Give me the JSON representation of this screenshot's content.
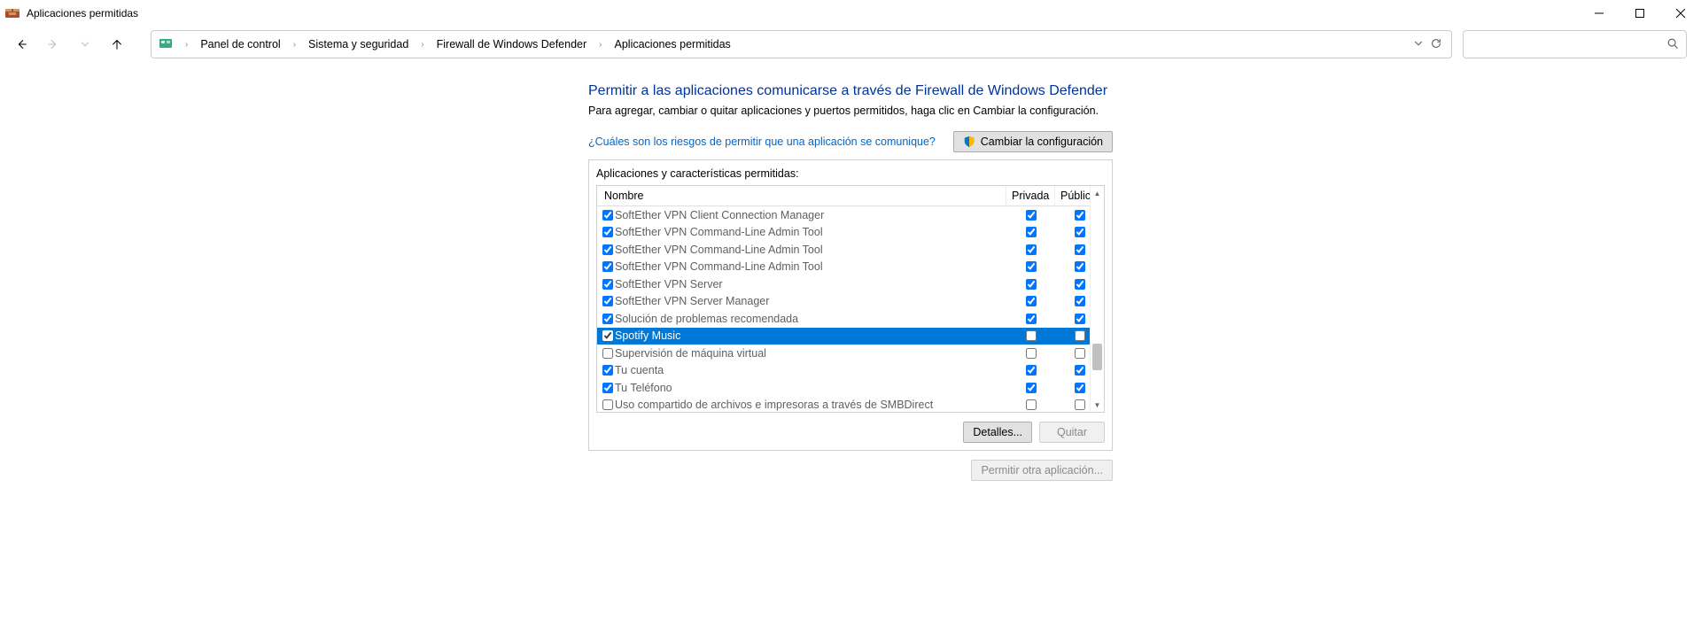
{
  "window": {
    "title": "Aplicaciones permitidas"
  },
  "breadcrumb": {
    "items": [
      "Panel de control",
      "Sistema y seguridad",
      "Firewall de Windows Defender",
      "Aplicaciones permitidas"
    ]
  },
  "page": {
    "heading": "Permitir a las aplicaciones comunicarse a través de Firewall de Windows Defender",
    "subtext": "Para agregar, cambiar o quitar aplicaciones y puertos permitidos, haga clic en Cambiar la configuración.",
    "risks_link": "¿Cuáles son los riesgos de permitir que una aplicación se comunique?",
    "change_button": "Cambiar la configuración",
    "groupbox_label": "Aplicaciones y características permitidas:",
    "columns": {
      "name": "Nombre",
      "private": "Privada",
      "public": "Pública"
    },
    "details_button": "Detalles...",
    "remove_button": "Quitar",
    "allow_other_button": "Permitir otra aplicación..."
  },
  "apps": [
    {
      "enabled": true,
      "name": "SoftEther VPN Client Connection Manager",
      "private": true,
      "public": true,
      "selected": false
    },
    {
      "enabled": true,
      "name": "SoftEther VPN Command-Line Admin Tool",
      "private": true,
      "public": true,
      "selected": false
    },
    {
      "enabled": true,
      "name": "SoftEther VPN Command-Line Admin Tool",
      "private": true,
      "public": true,
      "selected": false
    },
    {
      "enabled": true,
      "name": "SoftEther VPN Command-Line Admin Tool",
      "private": true,
      "public": true,
      "selected": false
    },
    {
      "enabled": true,
      "name": "SoftEther VPN Server",
      "private": true,
      "public": true,
      "selected": false
    },
    {
      "enabled": true,
      "name": "SoftEther VPN Server Manager",
      "private": true,
      "public": true,
      "selected": false
    },
    {
      "enabled": true,
      "name": "Solución de problemas recomendada",
      "private": true,
      "public": true,
      "selected": false
    },
    {
      "enabled": true,
      "name": "Spotify Music",
      "private": false,
      "public": false,
      "selected": true
    },
    {
      "enabled": false,
      "name": "Supervisión de máquina virtual",
      "private": false,
      "public": false,
      "selected": false
    },
    {
      "enabled": true,
      "name": "Tu cuenta",
      "private": true,
      "public": true,
      "selected": false
    },
    {
      "enabled": true,
      "name": "Tu Teléfono",
      "private": true,
      "public": true,
      "selected": false
    },
    {
      "enabled": false,
      "name": "Uso compartido de archivos e impresoras a través de SMBDirect",
      "private": false,
      "public": false,
      "selected": false
    }
  ]
}
